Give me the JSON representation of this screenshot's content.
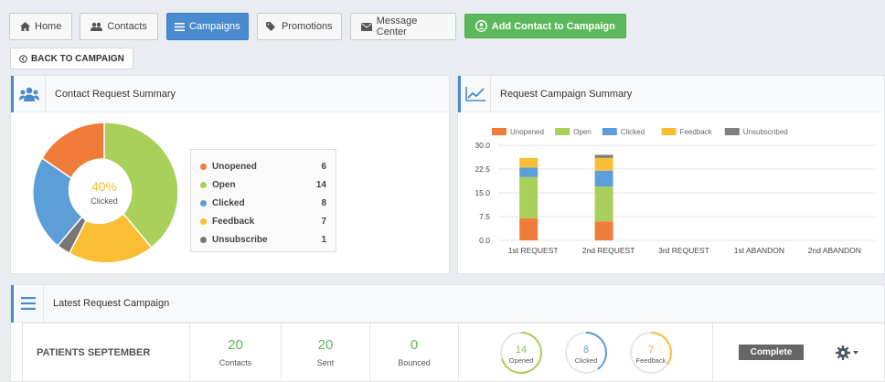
{
  "nav": {
    "home": "Home",
    "contacts": "Contacts",
    "campaigns": "Campaigns",
    "promotions": "Promotions",
    "message_center": "Message Center",
    "add_contact": "Add Contact to Campaign"
  },
  "back": "BACK TO CAMPAIGN",
  "summary": {
    "title": "Contact Request Summary",
    "center_pct": "40%",
    "center_label": "Clicked",
    "items": [
      {
        "label": "Unopened",
        "value": "6",
        "color": "#f07c3a"
      },
      {
        "label": "Open",
        "value": "14",
        "color": "#a8d05a"
      },
      {
        "label": "Clicked",
        "value": "8",
        "color": "#5c9fd8"
      },
      {
        "label": "Feedback",
        "value": "7",
        "color": "#fbbd33"
      },
      {
        "label": "Unsubscribe",
        "value": "1",
        "color": "#777777"
      }
    ]
  },
  "campaign_summary": {
    "title": "Request Campaign Summary"
  },
  "chart_data": {
    "type": "bar",
    "stacked": true,
    "categories": [
      "1st REQUEST",
      "2nd REQUEST",
      "3rd REQUEST",
      "1st ABANDON",
      "2nd ABANDON"
    ],
    "series": [
      {
        "name": "Unopened",
        "color": "#f07c3a",
        "values": [
          7,
          6,
          0,
          0,
          0
        ]
      },
      {
        "name": "Open",
        "color": "#a8d05a",
        "values": [
          13,
          11,
          0,
          0,
          0
        ]
      },
      {
        "name": "Clicked",
        "color": "#5c9fd8",
        "values": [
          3,
          5,
          0,
          0,
          0
        ]
      },
      {
        "name": "Feedback",
        "color": "#fbbd33",
        "values": [
          3,
          4,
          0,
          0,
          0
        ]
      },
      {
        "name": "Unsubscribed",
        "color": "#808080",
        "values": [
          0,
          1,
          0,
          0,
          0
        ]
      }
    ],
    "ylim": [
      0,
      30
    ],
    "yticks": [
      "30.0",
      "22.5",
      "15.0",
      "7.5",
      "0.0"
    ],
    "grid": true,
    "legend": "top"
  },
  "latest": {
    "title": "Latest Request Campaign",
    "name": "PATIENTS SEPTEMBER",
    "contacts": "20",
    "contacts_label": "Contacts",
    "sent": "20",
    "sent_label": "Sent",
    "bounced": "0",
    "bounced_label": "Bounced",
    "opened": "14",
    "opened_label": "Opened",
    "opened_fraction": 0.7,
    "clicked": "8",
    "clicked_label": "Clicked",
    "clicked_fraction": 0.4,
    "feedback": "7",
    "feedback_label": "Feedback",
    "feedback_fraction": 0.35,
    "status": "Complete"
  }
}
